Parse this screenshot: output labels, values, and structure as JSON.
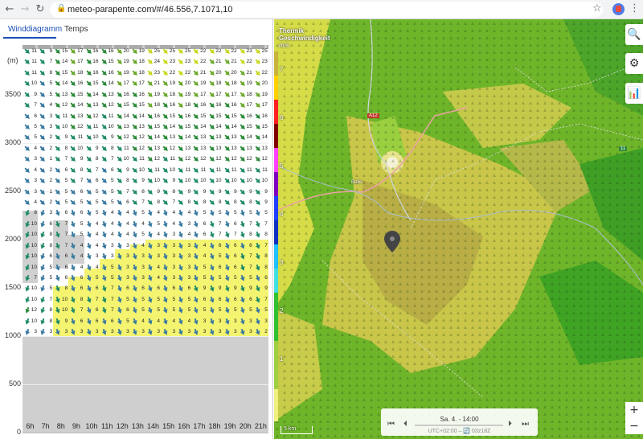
{
  "browser": {
    "url": "meteo-parapente.com/#/46.556,7.1071,10",
    "back": "←",
    "forward": "→",
    "reload": "↻",
    "lock": "🔒",
    "star": "☆",
    "menu": "⋮"
  },
  "tabs": [
    {
      "label": "Winddiagramm",
      "active": true
    },
    {
      "label": "Temps",
      "active": false
    }
  ],
  "diagram": {
    "unit": "(m)",
    "y_labels": [
      "3500",
      "3000",
      "2500",
      "2000",
      "1500",
      "1000",
      "500",
      "0"
    ],
    "hours": [
      "6h",
      "7h",
      "8h",
      "9h",
      "10h",
      "11h",
      "12h",
      "13h",
      "14h",
      "15h",
      "16h",
      "17h",
      "18h",
      "19h",
      "20h",
      "21h"
    ],
    "ground_altitude_m": 1000,
    "speeds": [
      [
        11,
        9,
        15,
        17,
        16,
        16,
        20,
        19,
        25,
        25,
        25,
        22,
        22,
        22,
        23,
        25
      ],
      [
        11,
        7,
        14,
        17,
        16,
        15,
        19,
        18,
        24,
        23,
        23,
        22,
        21,
        21,
        22,
        23
      ],
      [
        11,
        8,
        15,
        18,
        16,
        16,
        19,
        18,
        23,
        22,
        22,
        21,
        20,
        20,
        21,
        22
      ],
      [
        10,
        5,
        14,
        16,
        15,
        14,
        17,
        17,
        21,
        19,
        20,
        19,
        18,
        18,
        19,
        20
      ],
      [
        9,
        5,
        13,
        15,
        14,
        13,
        16,
        16,
        19,
        18,
        19,
        17,
        17,
        17,
        18,
        19
      ],
      [
        7,
        4,
        12,
        14,
        13,
        12,
        15,
        15,
        18,
        16,
        18,
        16,
        16,
        16,
        17,
        17
      ],
      [
        6,
        3,
        11,
        13,
        12,
        11,
        14,
        14,
        16,
        15,
        16,
        15,
        15,
        15,
        16,
        16
      ],
      [
        5,
        3,
        10,
        12,
        11,
        10,
        13,
        13,
        15,
        14,
        15,
        14,
        14,
        14,
        15,
        15
      ],
      [
        5,
        2,
        9,
        11,
        10,
        9,
        12,
        12,
        14,
        13,
        14,
        13,
        13,
        13,
        14,
        14
      ],
      [
        4,
        2,
        8,
        10,
        9,
        8,
        11,
        12,
        13,
        12,
        13,
        13,
        13,
        13,
        13,
        13
      ],
      [
        3,
        1,
        7,
        9,
        8,
        7,
        10,
        11,
        12,
        11,
        12,
        12,
        12,
        12,
        12,
        12
      ],
      [
        4,
        2,
        6,
        8,
        7,
        6,
        9,
        10,
        11,
        10,
        11,
        11,
        11,
        11,
        11,
        11
      ],
      [
        3,
        2,
        5,
        7,
        6,
        5,
        8,
        9,
        10,
        9,
        10,
        10,
        10,
        10,
        10,
        10
      ],
      [
        3,
        1,
        5,
        6,
        5,
        5,
        7,
        8,
        9,
        8,
        9,
        9,
        9,
        9,
        9,
        9
      ],
      [
        4,
        2,
        5,
        5,
        5,
        5,
        6,
        7,
        8,
        7,
        8,
        8,
        8,
        8,
        8,
        9
      ],
      [
        8,
        3,
        6,
        6,
        5,
        4,
        4,
        5,
        4,
        4,
        4,
        5,
        5,
        5,
        5,
        5
      ],
      [
        10,
        6,
        7,
        5,
        4,
        4,
        4,
        4,
        5,
        4,
        3,
        6,
        7,
        6,
        7,
        7
      ],
      [
        10,
        8,
        7,
        5,
        4,
        4,
        4,
        5,
        4,
        3,
        4,
        6,
        7,
        7,
        8,
        8
      ],
      [
        10,
        8,
        7,
        4,
        4,
        3,
        3,
        4,
        3,
        3,
        3,
        4,
        6,
        6,
        6,
        7
      ],
      [
        10,
        6,
        6,
        4,
        3,
        3,
        3,
        3,
        3,
        3,
        3,
        4,
        5,
        6,
        7,
        8
      ],
      [
        10,
        5,
        6,
        4,
        4,
        5,
        3,
        3,
        4,
        3,
        3,
        5,
        6,
        6,
        7,
        8
      ],
      [
        7,
        5,
        6,
        6,
        5,
        5,
        3,
        3,
        4,
        3,
        3,
        5,
        5,
        5,
        5,
        6
      ],
      [
        10,
        5,
        8,
        6,
        6,
        7,
        6,
        6,
        6,
        6,
        6,
        9,
        9,
        9,
        9,
        9
      ],
      [
        10,
        7,
        10,
        8,
        7,
        7,
        5,
        5,
        5,
        5,
        5,
        6,
        6,
        6,
        6,
        7
      ],
      [
        12,
        8,
        10,
        7,
        6,
        7,
        6,
        5,
        5,
        5,
        5,
        5,
        5,
        5,
        5,
        5
      ],
      [
        10,
        8,
        9,
        6,
        6,
        6,
        5,
        4,
        4,
        4,
        4,
        3,
        3,
        3,
        3,
        3
      ],
      [
        3,
        3,
        3,
        3,
        3,
        3,
        3,
        3,
        3,
        3,
        3,
        3,
        3,
        3,
        3,
        2
      ]
    ]
  },
  "map": {
    "title_line1": "Thermik",
    "title_line2": "Geschwindigkeit",
    "unit": "m/s",
    "legend_ticks": [
      "7",
      "6",
      "5",
      "4",
      "3",
      "2",
      "1"
    ],
    "scale": "5 km",
    "time": "Sa. 4. - 14:00",
    "subtime": "UTC+02:00 – 🔄 03z18Z",
    "road_a12": "A12",
    "road_11": "11",
    "town": "Bulle",
    "zoom_in": "+",
    "zoom_out": "−",
    "colors": {
      "thermal_green": "#5cb82a",
      "thermal_yellow": "#d8e050",
      "marker": "#444444"
    }
  },
  "controls": {
    "search": "🔍",
    "settings": "⚙",
    "chart": "📊"
  }
}
